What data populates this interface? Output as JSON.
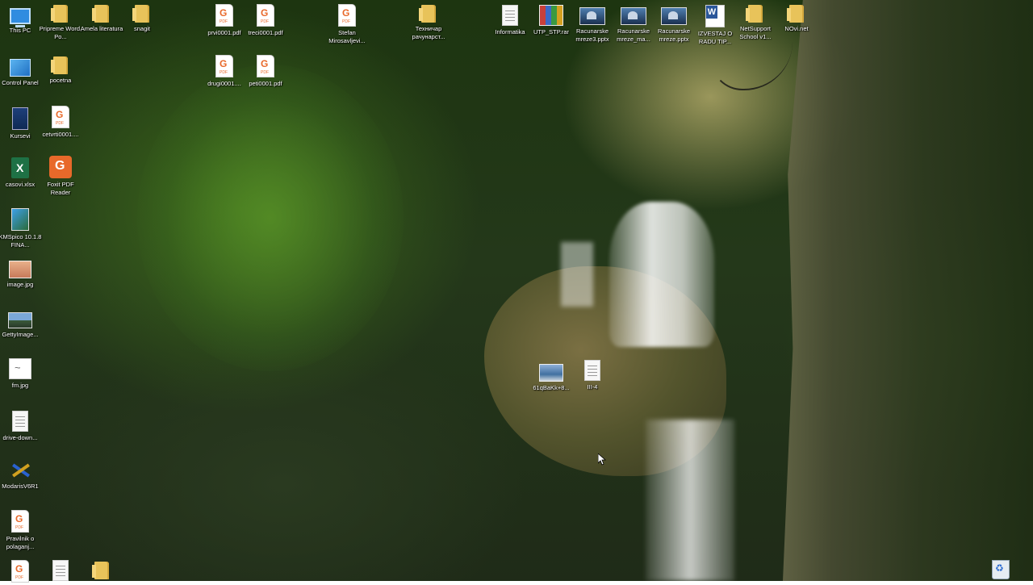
{
  "desktop": {
    "icons": [
      {
        "label": "This PC",
        "icon": "this-pc-icon"
      },
      {
        "label": "Pripreme Word, Po...",
        "icon": "folder-icon"
      },
      {
        "label": "Amela literatura",
        "icon": "folder-icon"
      },
      {
        "label": "snagit",
        "icon": "folder-icon"
      },
      {
        "label": "prvi0001.pdf",
        "icon": "pdf-icon"
      },
      {
        "label": "treci0001.pdf",
        "icon": "pdf-icon"
      },
      {
        "label": "Stefan Mirosavljevi...",
        "icon": "pdf-icon"
      },
      {
        "label": "Техничар рачунарст...",
        "icon": "folder-icon"
      },
      {
        "label": "Informatika",
        "icon": "document-icon"
      },
      {
        "label": "UTP_STP.rar",
        "icon": "rar-archive-icon"
      },
      {
        "label": "Racunarske mreze3.pptx",
        "icon": "powerpoint-icon"
      },
      {
        "label": "Racunarske mreze_ma...",
        "icon": "powerpoint-icon"
      },
      {
        "label": "Racunarske mreze.pptx",
        "icon": "powerpoint-icon"
      },
      {
        "label": "IZVESTAJ O RADU TIP...",
        "icon": "word-icon"
      },
      {
        "label": "NetSupport School v1...",
        "icon": "folder-icon"
      },
      {
        "label": "NOvi.net",
        "icon": "folder-icon"
      },
      {
        "label": "Control Panel",
        "icon": "control-panel-icon"
      },
      {
        "label": "pocetna",
        "icon": "folder-icon"
      },
      {
        "label": "drugi0001....",
        "icon": "pdf-icon"
      },
      {
        "label": "peti0001.pdf",
        "icon": "pdf-icon"
      },
      {
        "label": "Kursevi",
        "icon": "kursevi-icon"
      },
      {
        "label": "cetvrti0001....",
        "icon": "pdf-icon"
      },
      {
        "label": "casovi.xlsx",
        "icon": "excel-icon"
      },
      {
        "label": "Foxit PDF Reader",
        "icon": "foxit-reader-icon"
      },
      {
        "label": "KMSpico 10.1.8 FINA...",
        "icon": "kmspico-icon"
      },
      {
        "label": "image.jpg",
        "icon": "image-icon"
      },
      {
        "label": "GettyImage...",
        "icon": "photo-icon"
      },
      {
        "label": "fm.jpg",
        "icon": "image-icon"
      },
      {
        "label": "drive-down...",
        "icon": "document-icon"
      },
      {
        "label": "ModarisV6R1",
        "icon": "modaris-icon"
      },
      {
        "label": "Pravilnik o polaganj...",
        "icon": "pdf-icon"
      },
      {
        "label": "61qBaKk+8...",
        "icon": "photo-icon"
      },
      {
        "label": "III-4",
        "icon": "document-icon"
      },
      {
        "label": "",
        "icon": "pdf-icon"
      },
      {
        "label": "",
        "icon": "document-icon"
      },
      {
        "label": "",
        "icon": "folder-icon"
      },
      {
        "label": "",
        "icon": "recycle-bin-icon"
      }
    ]
  },
  "wallpaper": {
    "subject": "waterfall-canyon"
  }
}
